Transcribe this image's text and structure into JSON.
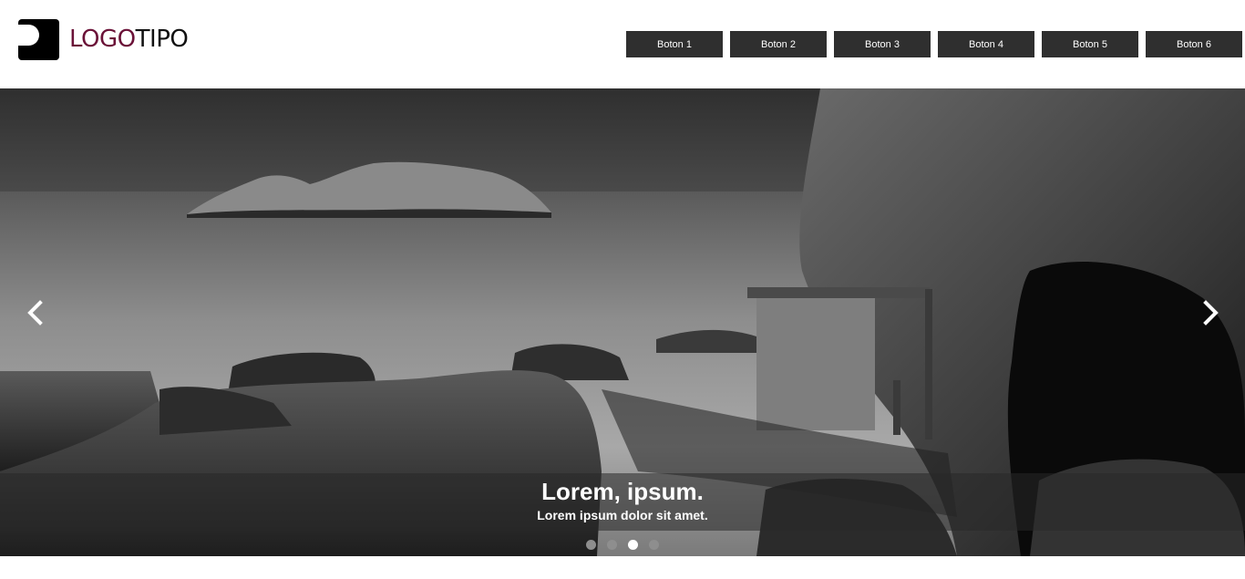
{
  "header": {
    "logo": {
      "part1": "LOGO",
      "part2": "TIPO",
      "accent_color": "#6b1238"
    },
    "nav": [
      {
        "label": "Boton 1"
      },
      {
        "label": "Boton 2"
      },
      {
        "label": "Boton 3"
      },
      {
        "label": "Boton 4"
      },
      {
        "label": "Boton 5"
      },
      {
        "label": "Boton 6"
      }
    ],
    "nav_bg_color": "#2f2f2f"
  },
  "slider": {
    "caption_title": "Lorem, ipsum.",
    "caption_text": "Lorem ipsum dolor sit amet.",
    "prev_icon": "chevron-left-icon",
    "next_icon": "chevron-right-icon",
    "slide_count": 4,
    "active_index": 2
  }
}
